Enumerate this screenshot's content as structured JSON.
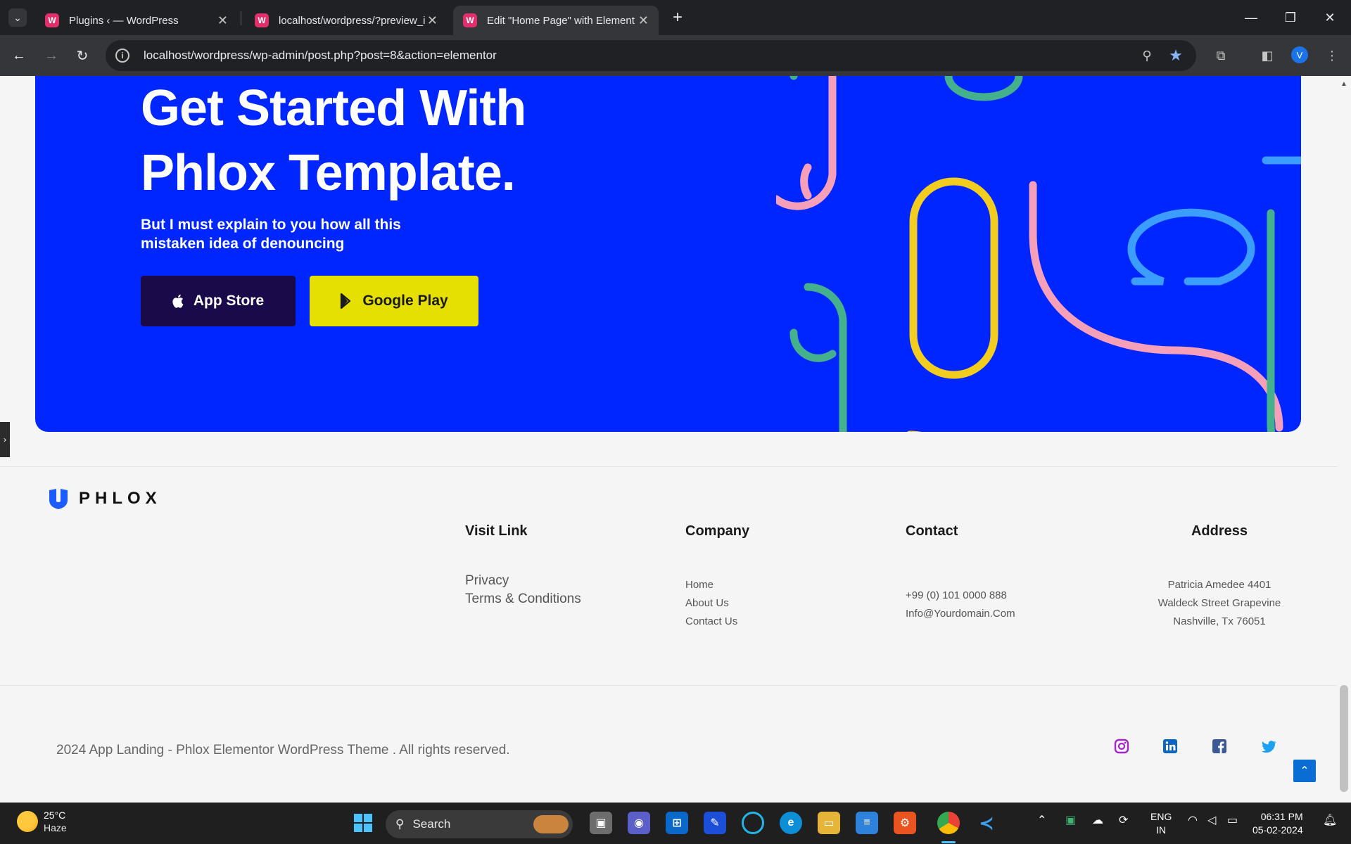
{
  "browser": {
    "tabs": [
      {
        "title": "Plugins ‹ — WordPress",
        "active": false
      },
      {
        "title": "localhost/wordpress/?preview_i",
        "active": false
      },
      {
        "title": "Edit \"Home Page\" with Element",
        "active": true
      }
    ],
    "url": "localhost/wordpress/wp-admin/post.php?post=8&action=elementor",
    "profile_initial": "V"
  },
  "hero": {
    "title": "Get Started With Phlox Template.",
    "subtitle": "But I must explain to you how all this mistaken idea of denouncing",
    "app_store_label": "App Store",
    "google_play_label": "Google Play",
    "background": "#0026ff"
  },
  "footer": {
    "logo_text": "PHLOX",
    "columns": {
      "visit": {
        "heading": "Visit Link",
        "links": [
          "Privacy",
          "Terms & Conditions"
        ]
      },
      "company": {
        "heading": "Company",
        "links": [
          "Home",
          "About Us",
          "Contact Us"
        ]
      },
      "contact": {
        "heading": "Contact",
        "lines": [
          "+99 (0) 101 0000 888",
          "Info@Yourdomain.Com"
        ]
      },
      "address": {
        "heading": "Address",
        "lines": [
          "Patricia Amedee 4401",
          "Waldeck Street Grapevine",
          "Nashville, Tx 76051"
        ]
      }
    },
    "copyright": "2024 App Landing - Phlox Elementor WordPress Theme . All rights reserved.",
    "social": [
      "instagram-icon",
      "linkedin-icon",
      "facebook-icon",
      "twitter-icon"
    ]
  },
  "taskbar": {
    "weather_temp": "25°C",
    "weather_cond": "Haze",
    "search_label": "Search",
    "lang_top": "ENG",
    "lang_bottom": "IN",
    "time": "06:31 PM",
    "date": "05-02-2024"
  }
}
